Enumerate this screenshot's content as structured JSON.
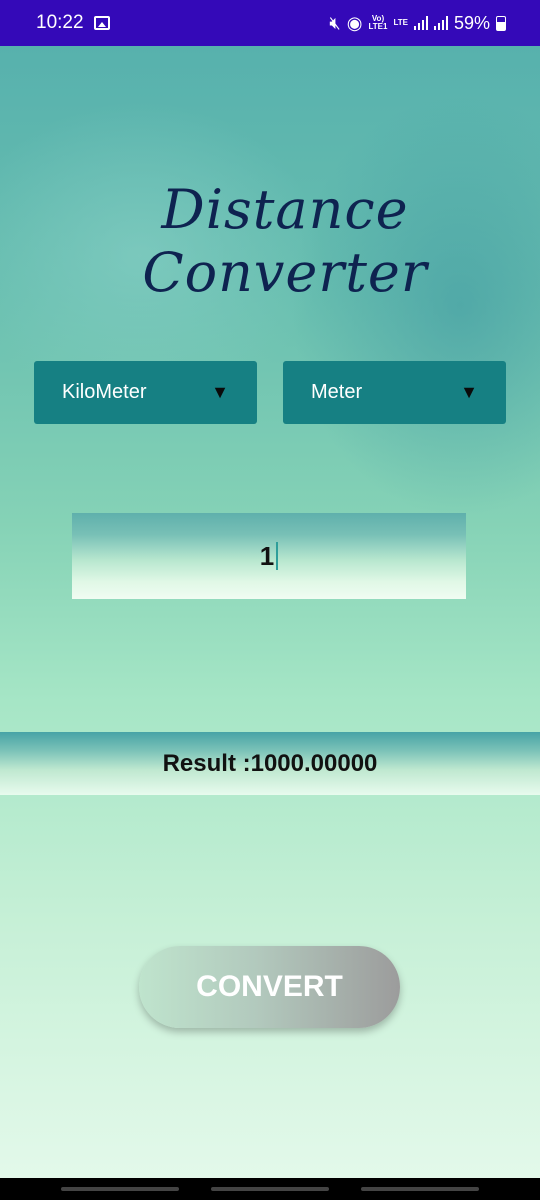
{
  "status_bar": {
    "time": "10:22",
    "network_top": "Vo)",
    "network_bottom": "LTE1",
    "lte_label": "LTE",
    "battery": "59%"
  },
  "app": {
    "title": "Distance Converter",
    "from_unit": "KiloMeter",
    "to_unit": "Meter",
    "dropdown_arrow": "▼",
    "input_value": "1",
    "result_text": "Result :1000.00000",
    "convert_label": "CONVERT"
  },
  "colors": {
    "status_bar": "#3409b8",
    "dropdown_bg": "#168083",
    "title": "#0e2350"
  }
}
